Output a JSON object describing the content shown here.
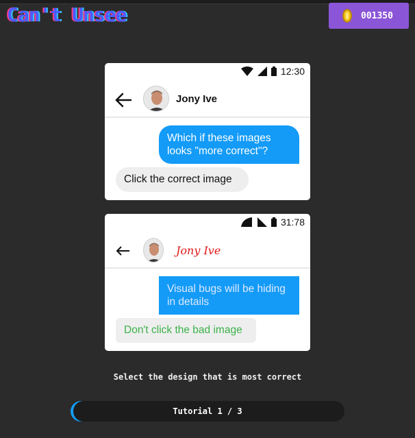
{
  "header": {
    "logo_text": "Can't Unsee",
    "coins": "001350",
    "coin_icon": "coin-icon"
  },
  "option_a": {
    "status_time": "12:30",
    "contact_name": "Jony Ive",
    "outgoing_message": "Which if these images looks \"more correct\"?",
    "incoming_message": "Click the correct image",
    "colors": {
      "bubble": "#139bf7",
      "incoming_bg": "#eeeeee"
    }
  },
  "option_b": {
    "status_time": "31:78",
    "contact_name": "Jony Ive",
    "outgoing_message": "Visual bugs will be hiding in details",
    "incoming_message": "Don't click the bad image",
    "colors": {
      "bubble": "#139bf7",
      "name": "#e01818",
      "incoming_text": "#3bb24a"
    }
  },
  "footer": {
    "instruction": "Select the design that is most correct",
    "progress_label": "Tutorial 1 / 3",
    "progress_fraction": 0.33
  }
}
